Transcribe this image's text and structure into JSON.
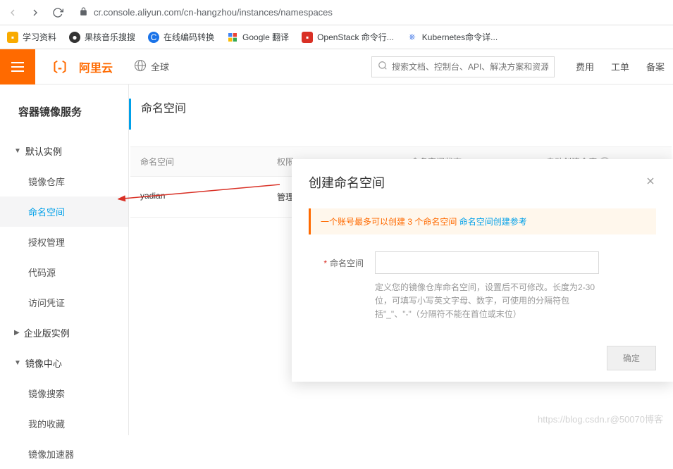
{
  "browser": {
    "url": "cr.console.aliyun.com/cn-hangzhou/instances/namespaces",
    "bookmarks": [
      {
        "label": "学习资料"
      },
      {
        "label": "果核音乐搜搜"
      },
      {
        "label": "在线编码转换"
      },
      {
        "label": "Google 翻译"
      },
      {
        "label": "OpenStack 命令行..."
      },
      {
        "label": "Kubernetes命令详..."
      }
    ]
  },
  "header": {
    "logo_text": "阿里云",
    "region": "全球",
    "search_placeholder": "搜索文档、控制台、API、解决方案和资源",
    "links": [
      "费用",
      "工单",
      "备案"
    ]
  },
  "sidebar": {
    "service_title": "容器镜像服务",
    "groups": [
      {
        "label": "默认实例",
        "expanded": true,
        "items": [
          {
            "label": "镜像仓库"
          },
          {
            "label": "命名空间",
            "active": true
          },
          {
            "label": "授权管理"
          },
          {
            "label": "代码源"
          },
          {
            "label": "访问凭证"
          }
        ]
      },
      {
        "label": "企业版实例",
        "expanded": false,
        "items": []
      },
      {
        "label": "镜像中心",
        "expanded": true,
        "items": [
          {
            "label": "镜像搜索"
          },
          {
            "label": "我的收藏"
          },
          {
            "label": "镜像加速器"
          }
        ]
      }
    ]
  },
  "content": {
    "page_title": "命名空间",
    "columns": [
      "命名空间",
      "权限",
      "命名空间状态",
      "自动创建仓库"
    ],
    "rows": [
      {
        "namespace": "yadian",
        "permission": "管理"
      }
    ]
  },
  "modal": {
    "title": "创建命名空间",
    "alert_text": "一个账号最多可以创建 3 个命名空间 ",
    "alert_link": "命名空间创建参考",
    "form_label": "命名空间",
    "hint": "定义您的镜像仓库命名空间，设置后不可修改。长度为2-30位，可填写小写英文字母、数字，可使用的分隔符包括\"_\"、\"-\"（分隔符不能在首位或末位）",
    "submit": "确定"
  },
  "watermark": "https://blog.csdn.r@50070博客"
}
